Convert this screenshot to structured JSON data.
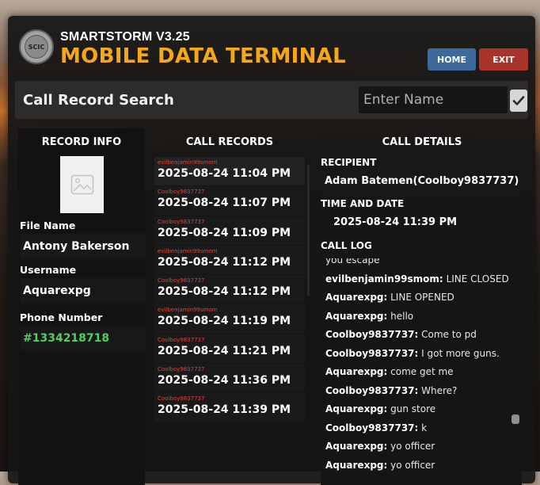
{
  "app": {
    "version_label": "SMARTSTORM V3.25",
    "title": "MOBILE DATA TERMINAL",
    "logo_text": "SCIC"
  },
  "nav": {
    "home_label": "HOME",
    "exit_label": "EXIT"
  },
  "search": {
    "title": "Call Record Search",
    "placeholder": "Enter Name",
    "checkbox_checked": true
  },
  "record_info": {
    "heading": "RECORD INFO",
    "file_name_label": "File Name",
    "file_name": "Antony Bakerson",
    "username_label": "Username",
    "username": "Aquarexpg",
    "phone_label": "Phone Number",
    "phone": "#1334218718",
    "phone_color": "#4fcf5f"
  },
  "call_records": {
    "heading": "CALL RECORDS",
    "items": [
      {
        "caller": "evilbenjamin99smom",
        "time": "2025-08-24 11:04 PM"
      },
      {
        "caller": "Coolboy9837737",
        "time": "2025-08-24 11:07 PM"
      },
      {
        "caller": "Coolboy9837737",
        "time": "2025-08-24 11:09 PM"
      },
      {
        "caller": "evilbenjamin99smom",
        "time": "2025-08-24 11:12 PM"
      },
      {
        "caller": "Coolboy9837737",
        "time": "2025-08-24 11:12 PM"
      },
      {
        "caller": "evilbenjamin99smom",
        "time": "2025-08-24 11:19 PM"
      },
      {
        "caller": "Coolboy9837737",
        "time": "2025-08-24 11:21 PM"
      },
      {
        "caller": "Coolboy9837737",
        "time": "2025-08-24 11:36 PM"
      },
      {
        "caller": "Coolboy9837737",
        "time": "2025-08-24 11:39 PM"
      }
    ]
  },
  "call_details": {
    "heading": "CALL DETAILS",
    "recipient_label": "RECIPIENT",
    "recipient": "Adam Batemen(Coolboy9837737)",
    "datetime_label": "TIME AND DATE",
    "datetime": "2025-08-24 11:39 PM",
    "log_label": "CALL LOG",
    "log": [
      {
        "speaker": "",
        "text": "you escape"
      },
      {
        "speaker": "evilbenjamin99smom:",
        "text": "LINE CLOSED"
      },
      {
        "speaker": "Aquarexpg:",
        "text": "LINE OPENED"
      },
      {
        "speaker": "Aquarexpg:",
        "text": "hello"
      },
      {
        "speaker": "Coolboy9837737:",
        "text": "Come to pd"
      },
      {
        "speaker": "Coolboy9837737:",
        "text": "I got more guns."
      },
      {
        "speaker": "Aquarexpg:",
        "text": "come get me"
      },
      {
        "speaker": "Coolboy9837737:",
        "text": "Where?"
      },
      {
        "speaker": "Aquarexpg:",
        "text": "gun store"
      },
      {
        "speaker": "Coolboy9837737:",
        "text": "k"
      },
      {
        "speaker": "Aquarexpg:",
        "text": "yo officer"
      },
      {
        "speaker": "Aquarexpg:",
        "text": "yo officer"
      }
    ]
  },
  "colors": {
    "accent_title": "#f5a71a",
    "home_button": "#3d6a9a",
    "exit_button": "#a8342c",
    "caller_red": "#d9443a"
  },
  "icons": {
    "logo": "agency-seal-icon",
    "check": "checkmark-icon",
    "photo": "image-placeholder-icon"
  }
}
